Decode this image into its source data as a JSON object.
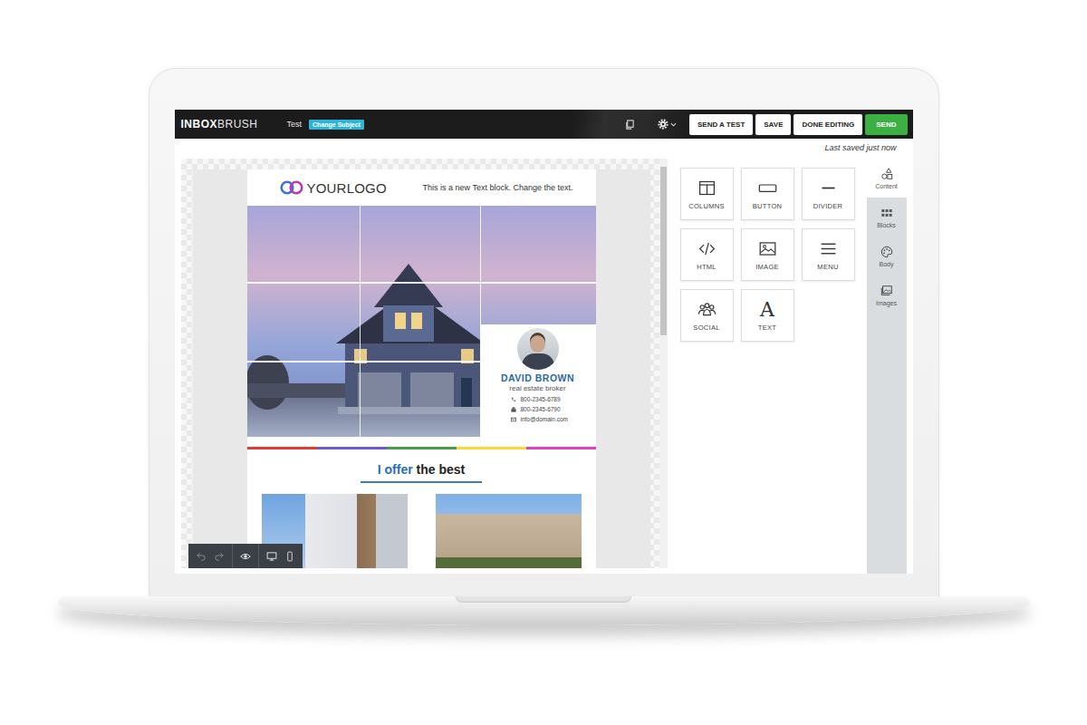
{
  "editor": {
    "logo": {
      "bold": "INBOX",
      "light": "BRUSH"
    },
    "subject": "Test",
    "change_subject": "Change Subject",
    "buttons": [
      {
        "label": "SEND A TEST",
        "kind": "plain"
      },
      {
        "label": "SAVE",
        "kind": "plain"
      },
      {
        "label": "DONE EDITING",
        "kind": "plain"
      },
      {
        "label": "SEND",
        "kind": "primary"
      }
    ],
    "save_status": "Last saved just now"
  },
  "content_tiles": [
    {
      "label": "COLUMNS",
      "kind": "columns"
    },
    {
      "label": "BUTTON",
      "kind": "button"
    },
    {
      "label": "DIVIDER",
      "kind": "divider"
    },
    {
      "label": "HTML",
      "kind": "html"
    },
    {
      "label": "IMAGE",
      "kind": "image"
    },
    {
      "label": "MENU",
      "kind": "menu"
    },
    {
      "label": "SOCIAL",
      "kind": "social"
    },
    {
      "label": "TEXT",
      "kind": "text",
      "glyph": "A"
    }
  ],
  "side_tabs": [
    {
      "label": "Content",
      "kind": "content",
      "selected": true
    },
    {
      "label": "Blocks",
      "kind": "blocks",
      "selected": false
    },
    {
      "label": "Body",
      "kind": "body",
      "selected": false
    },
    {
      "label": "Images",
      "kind": "images",
      "selected": false
    }
  ],
  "email": {
    "logo": "YOURLOGO",
    "header_text": "This is a new Text block. Change the text.",
    "agent": {
      "name": "DAVID BROWN",
      "title": "real estate broker",
      "contacts": [
        {
          "kind": "phone",
          "text": "800-2345-6789"
        },
        {
          "kind": "fax",
          "text": "800-2345-6790"
        },
        {
          "kind": "email",
          "text": "info@domain.com"
        }
      ]
    },
    "heading": {
      "accent": "I offer",
      "rest": "the best"
    }
  },
  "preview_toolbar": [
    {
      "kind": "undo",
      "disabled": true
    },
    {
      "kind": "redo",
      "disabled": true
    },
    {
      "kind": "preview",
      "disabled": false
    },
    {
      "kind": "desktop",
      "disabled": false
    },
    {
      "kind": "mobile",
      "disabled": false
    }
  ]
}
